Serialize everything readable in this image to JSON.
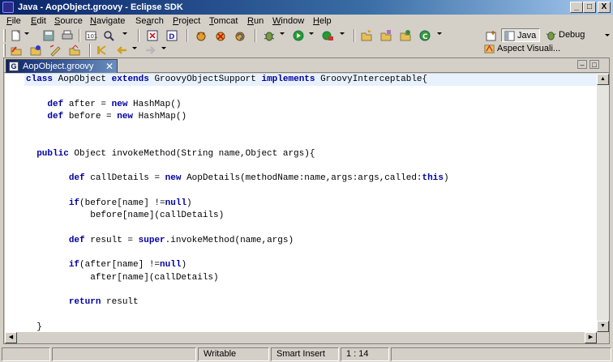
{
  "window": {
    "title": "Java - AopObject.groovy - Eclipse SDK",
    "controls": {
      "minimize": "_",
      "maximize": "□",
      "close": "X"
    }
  },
  "menubar": {
    "items": [
      {
        "label": "File",
        "underline": "F"
      },
      {
        "label": "Edit",
        "underline": "E"
      },
      {
        "label": "Source",
        "underline": "S"
      },
      {
        "label": "Navigate",
        "underline": "N"
      },
      {
        "label": "Search",
        "underline": "a"
      },
      {
        "label": "Project",
        "underline": "P"
      },
      {
        "label": "Tomcat",
        "underline": "T"
      },
      {
        "label": "Run",
        "underline": "R"
      },
      {
        "label": "Window",
        "underline": "W"
      },
      {
        "label": "Help",
        "underline": "H"
      }
    ]
  },
  "perspectives": {
    "java": "Java",
    "debug": "Debug",
    "aspect": "Aspect Visuali..."
  },
  "editor": {
    "tab_label": "AopObject.groovy",
    "tab_close": "✕",
    "tab_icon": "G",
    "code_lines": [
      [
        {
          "t": "class",
          "k": 1
        },
        {
          "t": " AopObject "
        },
        {
          "t": "extends",
          "k": 1
        },
        {
          "t": " GroovyObjectSupport "
        },
        {
          "t": "implements",
          "k": 1
        },
        {
          "t": " GroovyInterceptable{"
        }
      ],
      [],
      [
        {
          "t": "    "
        },
        {
          "t": "def",
          "k": 1
        },
        {
          "t": " after = "
        },
        {
          "t": "new",
          "k": 1
        },
        {
          "t": " HashMap()"
        }
      ],
      [
        {
          "t": "    "
        },
        {
          "t": "def",
          "k": 1
        },
        {
          "t": " before = "
        },
        {
          "t": "new",
          "k": 1
        },
        {
          "t": " HashMap()"
        }
      ],
      [],
      [],
      [
        {
          "t": "  "
        },
        {
          "t": "public",
          "k": 1
        },
        {
          "t": " Object invokeMethod(String name,Object args){"
        }
      ],
      [],
      [
        {
          "t": "        "
        },
        {
          "t": "def",
          "k": 1
        },
        {
          "t": " callDetails = "
        },
        {
          "t": "new",
          "k": 1
        },
        {
          "t": " AopDetails(methodName:name,args:args,called:"
        },
        {
          "t": "this",
          "k": 1
        },
        {
          "t": ")"
        }
      ],
      [],
      [
        {
          "t": "        "
        },
        {
          "t": "if",
          "k": 1
        },
        {
          "t": "(before[name] !="
        },
        {
          "t": "null",
          "k": 1
        },
        {
          "t": ")"
        }
      ],
      [
        {
          "t": "            before[name](callDetails)"
        }
      ],
      [],
      [
        {
          "t": "        "
        },
        {
          "t": "def",
          "k": 1
        },
        {
          "t": " result = "
        },
        {
          "t": "super",
          "k": 1
        },
        {
          "t": ".invokeMethod(name,args)"
        }
      ],
      [],
      [
        {
          "t": "        "
        },
        {
          "t": "if",
          "k": 1
        },
        {
          "t": "(after[name] !="
        },
        {
          "t": "null",
          "k": 1
        },
        {
          "t": ")"
        }
      ],
      [
        {
          "t": "            after[name](callDetails)"
        }
      ],
      [],
      [
        {
          "t": "        "
        },
        {
          "t": "return",
          "k": 1
        },
        {
          "t": " result"
        }
      ],
      [],
      [
        {
          "t": "  }"
        }
      ],
      [],
      [
        {
          "t": "}"
        }
      ]
    ]
  },
  "statusbar": {
    "mode": "Writable",
    "insert": "Smart Insert",
    "position": "1 : 14"
  },
  "colors": {
    "keyword": "#0000a0",
    "current_line": "#e8f2fe",
    "title_start": "#0a246a",
    "title_end": "#a6caf0"
  }
}
